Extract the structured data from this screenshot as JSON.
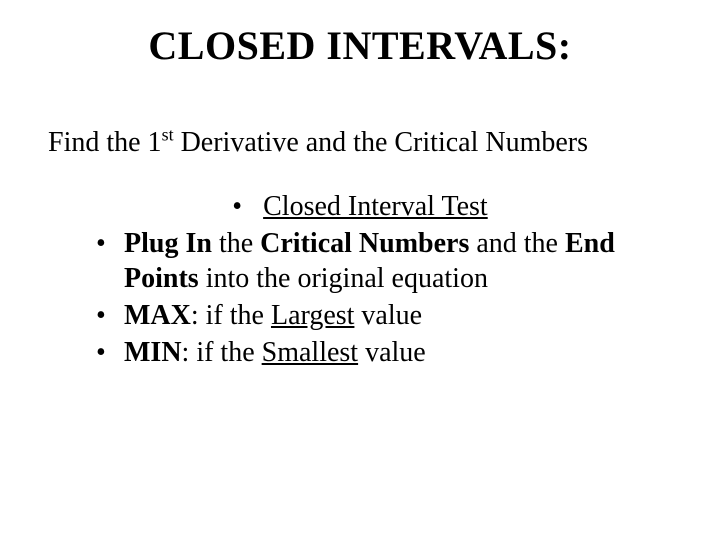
{
  "title": "CLOSED INTERVALS:",
  "subtitle": {
    "prefix": "Find the 1",
    "sup": "st",
    "rest": " Derivative and the Critical Numbers"
  },
  "bullets": {
    "dot": "•",
    "first": "Closed Interval Test",
    "second": {
      "a": "Plug In",
      "b": " the ",
      "c": "Critical Numbers",
      "d": " and the ",
      "e": "End Points",
      "f": " into the original equation"
    },
    "third": {
      "a": "MAX",
      "b": ": if the ",
      "c": "Largest",
      "d": " value"
    },
    "fourth": {
      "a": "MIN",
      "b": ": if the ",
      "c": "Smallest",
      "d": " value"
    }
  }
}
